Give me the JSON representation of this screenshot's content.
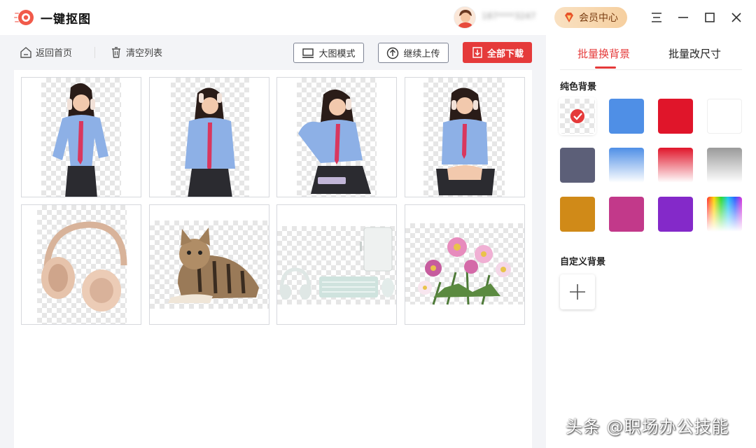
{
  "app": {
    "title": "一键抠图"
  },
  "user": {
    "name": "187****3247"
  },
  "header": {
    "vip_label": "会员中心"
  },
  "toolbar": {
    "home_label": "返回首页",
    "clear_label": "清空列表",
    "large_mode_label": "大图模式",
    "continue_upload_label": "继续上传",
    "download_all_label": "全部下载"
  },
  "images": [
    {
      "subject": "girl-headphones-1"
    },
    {
      "subject": "girl-headphones-2"
    },
    {
      "subject": "girl-headphones-3"
    },
    {
      "subject": "girl-headphones-4"
    },
    {
      "subject": "headphones"
    },
    {
      "subject": "cat"
    },
    {
      "subject": "keyboard-desk"
    },
    {
      "subject": "flowers"
    }
  ],
  "side": {
    "tabs": [
      {
        "label": "批量换背景",
        "active": true
      },
      {
        "label": "批量改尺寸",
        "active": false
      }
    ],
    "solid_label": "纯色背景",
    "custom_label": "自定义背景",
    "swatches": [
      {
        "name": "transparent",
        "color": "checker",
        "selected": true
      },
      {
        "name": "blue",
        "color": "#4f8fe6"
      },
      {
        "name": "red",
        "color": "#e0152a"
      },
      {
        "name": "white",
        "color": "#ffffff"
      },
      {
        "name": "slate",
        "color": "#5c5f78"
      },
      {
        "name": "blue-gradient",
        "color": "#4f8fe6"
      },
      {
        "name": "red-gradient",
        "color": "#e0152a"
      },
      {
        "name": "gray-gradient",
        "color": "#9a9a9a"
      },
      {
        "name": "amber",
        "color": "#d08a18"
      },
      {
        "name": "magenta",
        "color": "#c2398a"
      },
      {
        "name": "purple",
        "color": "#8429c9"
      },
      {
        "name": "rainbow",
        "color": "rainbow"
      }
    ]
  },
  "watermark": "头条 @职场办公技能"
}
